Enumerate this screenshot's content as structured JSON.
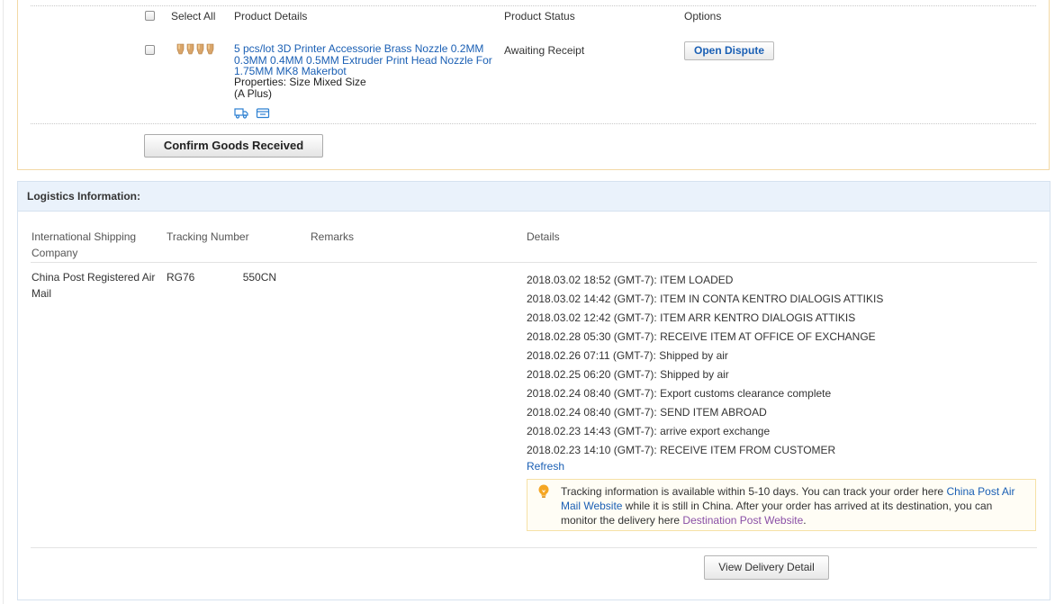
{
  "order": {
    "select_all_label": "Select All",
    "headers": {
      "product_details": "Product Details",
      "product_status": "Product Status",
      "options": "Options"
    },
    "product": {
      "title": "5 pcs/lot 3D Printer Accessorie Brass Nozzle 0.2MM 0.3MM 0.4MM 0.5MM Extruder Print Head Nozzle For 1.75MM MK8 Makerbot",
      "properties": "Properties: Size Mixed Size",
      "variant": "(A Plus)",
      "status": "Awaiting Receipt",
      "dispute_label": "Open Dispute"
    },
    "confirm_label": "Confirm Goods Received"
  },
  "logistics": {
    "title": "Logistics Information:",
    "headers": {
      "company": "International Shipping Company",
      "tracking": "Tracking Number",
      "remarks": "Remarks",
      "details": "Details"
    },
    "company": "China Post Registered Air Mail",
    "tracking_number": "RG76                550CN",
    "events": [
      "2018.03.02 18:52 (GMT-7): ITEM LOADED",
      "2018.03.02 14:42 (GMT-7): ITEM IN CONTA KENTRO DIALOGIS ATTIKIS",
      "2018.03.02 12:42 (GMT-7): ITEM ARR KENTRO DIALOGIS ATTIKIS",
      "2018.02.28 05:30 (GMT-7): RECEIVE ITEM AT OFFICE OF EXCHANGE",
      "2018.02.26 07:11 (GMT-7): Shipped by air",
      "2018.02.25 06:20 (GMT-7): Shipped by air",
      "2018.02.24 08:40 (GMT-7): Export customs clearance complete",
      "2018.02.24 08:40 (GMT-7): SEND ITEM ABROAD",
      "2018.02.23 14:43 (GMT-7): arrive export exchange",
      "2018.02.23 14:10 (GMT-7): RECEIVE ITEM FROM CUSTOMER"
    ],
    "refresh_label": "Refresh",
    "notice": {
      "text1": "Tracking information is available within 5-10 days. You can track your order here ",
      "link1": "China Post Air Mail Website",
      "text2": " while it is still in China. After your order has arrived at its destination, you can monitor the delivery here ",
      "link2": "Destination Post Website",
      "text3": "."
    },
    "view_delivery_label": "View Delivery Detail"
  },
  "icons": {
    "product_thumbnail": "brass-nozzles-image",
    "shipping": "truck-icon",
    "snapshot": "snapshot-icon",
    "tip": "lightbulb-icon"
  },
  "colors": {
    "link": "#1a5fb4",
    "visited_link": "#8a4fa6",
    "order_border": "#f3d9a6",
    "logistics_header_bg": "#eaf2fb",
    "tip_icon": "#f5a623"
  }
}
